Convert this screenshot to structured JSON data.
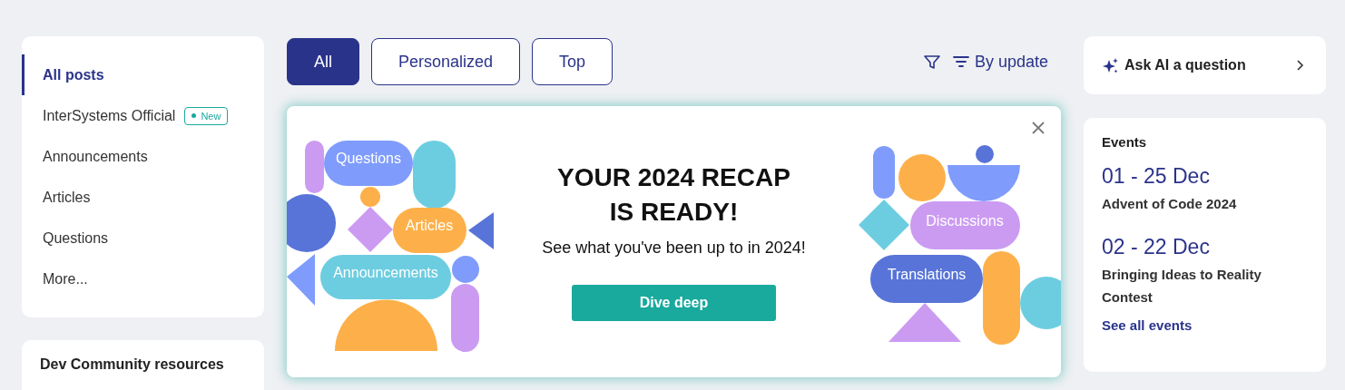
{
  "sidebar": {
    "items": [
      {
        "label": "All posts",
        "selected": true
      },
      {
        "label": "InterSystems Official",
        "selected": false,
        "badge": "New"
      },
      {
        "label": "Announcements",
        "selected": false
      },
      {
        "label": "Articles",
        "selected": false
      },
      {
        "label": "Questions",
        "selected": false
      },
      {
        "label": "More...",
        "selected": false
      }
    ]
  },
  "resources_card": {
    "title": "Dev Community resources"
  },
  "feed": {
    "tabs": [
      {
        "label": "All",
        "selected": true
      },
      {
        "label": "Personalized",
        "selected": false
      },
      {
        "label": "Top",
        "selected": false
      }
    ],
    "sort": {
      "label": "By update"
    }
  },
  "banner": {
    "title_lines": [
      "YOUR 2024 RECAP",
      "IS READY!"
    ],
    "subtitle": "See what you've been up to in 2024!",
    "button": "Dive deep",
    "illustration_labels": [
      "Questions",
      "Articles",
      "Announcements",
      "Discussions",
      "Translations"
    ]
  },
  "ai_card": {
    "label": "Ask AI a question"
  },
  "events": {
    "title": "Events",
    "items": [
      {
        "date": "01 - 25 Dec",
        "name": "Advent of Code 2024"
      },
      {
        "date": "02 - 22 Dec",
        "name": "Bringing Ideas to Reality Contest"
      }
    ],
    "link": "See all events"
  }
}
